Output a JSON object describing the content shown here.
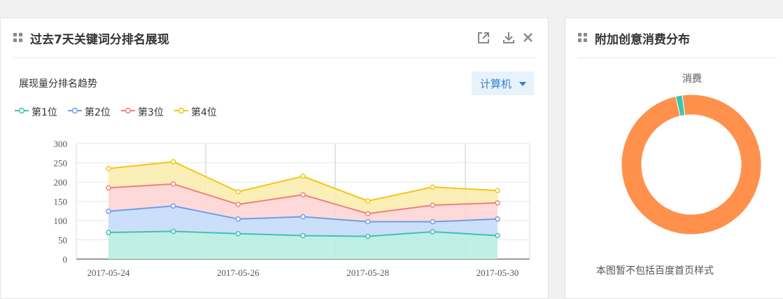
{
  "left_panel": {
    "title": "过去7天关键词分排名展现",
    "subtitle": "展现量分排名趋势",
    "device_select": {
      "value": "计算机",
      "icon": "caret-down-icon"
    },
    "toolbar_icons": [
      "external-link-icon",
      "download-icon",
      "close-icon"
    ]
  },
  "right_panel": {
    "title": "附加创意消费分布",
    "donut_title": "消费",
    "note": "本图暂不包括百度首页样式"
  },
  "colors": {
    "series": [
      "#3cc4b0",
      "#6d9fe8",
      "#f07f7a",
      "#f5c518"
    ],
    "fills": [
      "#b9ede3",
      "#c6dcf9",
      "#fdd5d5",
      "#fbedb0"
    ],
    "donut": [
      "#ff914d",
      "#3cc4b0"
    ]
  },
  "chart_data": [
    {
      "type": "area",
      "title": "展现量分排名趋势",
      "x": [
        "2017-05-24",
        "2017-05-25",
        "2017-05-26",
        "2017-05-27",
        "2017-05-28",
        "2017-05-29",
        "2017-05-30"
      ],
      "x_tick_labels": [
        "2017-05-24",
        "2017-05-26",
        "2017-05-28",
        "2017-05-30"
      ],
      "stacked": true,
      "series": [
        {
          "name": "第1位",
          "values": [
            69,
            72,
            66,
            61,
            59,
            71,
            61
          ]
        },
        {
          "name": "第2位",
          "values": [
            55,
            66,
            38,
            49,
            38,
            26,
            43
          ]
        },
        {
          "name": "第3位",
          "values": [
            61,
            57,
            38,
            57,
            21,
            43,
            42
          ]
        },
        {
          "name": "第4位",
          "values": [
            50,
            58,
            33,
            48,
            33,
            47,
            32
          ]
        }
      ],
      "ylim": [
        0,
        300
      ],
      "yticks": [
        0,
        50,
        100,
        150,
        200,
        250,
        300
      ],
      "grid": true,
      "legend": "top-left"
    },
    {
      "type": "pie",
      "title": "消费",
      "donut": true,
      "slices": [
        {
          "value": 98.5
        },
        {
          "value": 1.5
        }
      ]
    }
  ]
}
